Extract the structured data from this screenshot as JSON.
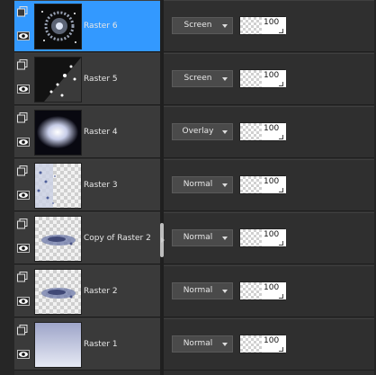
{
  "layers": [
    {
      "name": "Raster 6",
      "blend": "Screen",
      "opacity": "100",
      "selected": true,
      "thumb": "starfield"
    },
    {
      "name": "Raster 5",
      "blend": "Screen",
      "opacity": "100",
      "selected": false,
      "thumb": "stars-diagonal"
    },
    {
      "name": "Raster 4",
      "blend": "Overlay",
      "opacity": "100",
      "selected": false,
      "thumb": "glow"
    },
    {
      "name": "Raster 3",
      "blend": "Normal",
      "opacity": "100",
      "selected": false,
      "thumb": "dust-left"
    },
    {
      "name": "Copy of Raster 2",
      "blend": "Normal",
      "opacity": "100",
      "selected": false,
      "thumb": "streak"
    },
    {
      "name": "Raster 2",
      "blend": "Normal",
      "opacity": "100",
      "selected": false,
      "thumb": "streak"
    },
    {
      "name": "Raster 1",
      "blend": "Normal",
      "opacity": "100",
      "selected": false,
      "thumb": "gradient"
    }
  ],
  "colors": {
    "selection": "#3399ff",
    "panel": "#2f2f2f",
    "row": "#3a3a3a"
  }
}
